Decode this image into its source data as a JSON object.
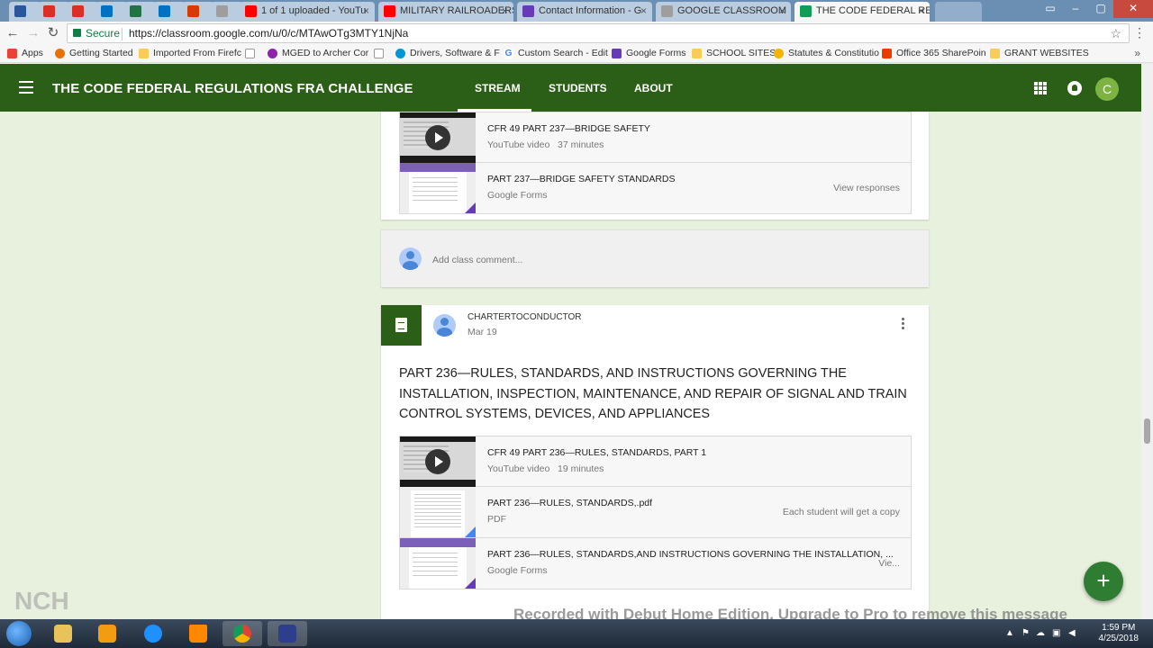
{
  "browser": {
    "tabs": [
      {
        "label": "",
        "color": "#2b579a"
      },
      {
        "label": "",
        "color": "#d93025"
      },
      {
        "label": "",
        "color": "#d93025"
      },
      {
        "label": "",
        "color": "#0072c6"
      },
      {
        "label": "",
        "color": "#217346"
      },
      {
        "label": "",
        "color": "#0072c6"
      },
      {
        "label": "",
        "color": "#d83b01"
      },
      {
        "label": "",
        "color": "#9e9e9e"
      },
      {
        "label": "1 of 1 uploaded - YouTu",
        "color": "#ff0000"
      },
      {
        "label": "MILITARY RAILROADERS",
        "color": "#ff0000"
      },
      {
        "label": "Contact Information - G",
        "color": "#673ab7"
      },
      {
        "label": "GOOGLE CLASSROOM",
        "color": "#9e9e9e"
      },
      {
        "label": "THE CODE FEDERAL REG",
        "color": "#0f9d58"
      }
    ],
    "secure_label": "Secure",
    "url": "https://classroom.google.com/u/0/c/MTAwOTg3MTY1NjNa",
    "bookmarks": [
      {
        "label": "Apps",
        "color": "#ea4335"
      },
      {
        "label": "Getting Started",
        "color": "#e8710a"
      },
      {
        "label": "Imported From Firefc",
        "color": "#f9cb57"
      },
      {
        "label": "",
        "color": "#9e9e9e"
      },
      {
        "label": "MGED to Archer Cor",
        "color": "#8e24aa"
      },
      {
        "label": "",
        "color": "#9e9e9e"
      },
      {
        "label": "Drivers, Software & F",
        "color": "#0096d6"
      },
      {
        "label": "Custom Search - Edit",
        "color": "#4285f4"
      },
      {
        "label": "Google Forms",
        "color": "#673ab7"
      },
      {
        "label": "SCHOOL SITES",
        "color": "#f9cb57"
      },
      {
        "label": "Statutes & Constitutio",
        "color": "#f4b400"
      },
      {
        "label": "Office 365 SharePoin",
        "color": "#eb3c00"
      },
      {
        "label": "GRANT WEBSITES",
        "color": "#f9cb57"
      }
    ]
  },
  "classroom": {
    "title": "THE CODE FEDERAL REGULATIONS FRA CHALLENGE",
    "nav": [
      "STREAM",
      "STUDENTS",
      "ABOUT"
    ],
    "user_initial": "C",
    "accent": "#2b5e16"
  },
  "post1": {
    "attachments": [
      {
        "title": "CFR 49 PART 237—BRIDGE SAFETY",
        "sub": "YouTube video   37 minutes",
        "right": "",
        "kind": "video"
      },
      {
        "title": "PART 237—BRIDGE SAFETY STANDARDS",
        "sub": "Google Forms",
        "right": "View responses",
        "kind": "form"
      }
    ],
    "comment_placeholder": "Add class comment..."
  },
  "post2": {
    "author": "CHARTERTOCONDUCTOR",
    "date": "Mar 19",
    "title": "PART 236—RULES, STANDARDS, AND INSTRUCTIONS GOVERNING THE INSTALLATION, INSPECTION, MAINTENANCE, AND REPAIR OF SIGNAL AND TRAIN CONTROL SYSTEMS, DEVICES, AND APPLIANCES",
    "attachments": [
      {
        "title": "CFR 49 PART 236—RULES, STANDARDS, PART 1",
        "sub": "YouTube video   19 minutes",
        "right": "",
        "kind": "video"
      },
      {
        "title": "PART 236—RULES, STANDARDS,.pdf",
        "sub": "PDF",
        "right": "Each student will get a copy",
        "kind": "pdf"
      },
      {
        "title": "PART 236—RULES, STANDARDS,AND INSTRUCTIONS GOVERNING THE INSTALLATION, ...",
        "sub": "Google Forms",
        "right": "Vie...",
        "kind": "form"
      }
    ]
  },
  "fab_label": "+",
  "watermark": "Recorded with Debut Home Edition. Upgrade to Pro to remove this message",
  "taskbar": {
    "apps": [
      {
        "name": "file-explorer-icon",
        "color": "#e8c35a"
      },
      {
        "name": "media-player-icon",
        "color": "#f39c12"
      },
      {
        "name": "internet-explorer-icon",
        "color": "#1e90ff"
      },
      {
        "name": "vlc-icon",
        "color": "#ff8800"
      },
      {
        "name": "chrome-icon",
        "color": "#4caf50"
      },
      {
        "name": "debut-recorder-icon",
        "color": "#2c3e8c"
      }
    ],
    "time": "1:59 PM",
    "date": "4/25/2018"
  }
}
